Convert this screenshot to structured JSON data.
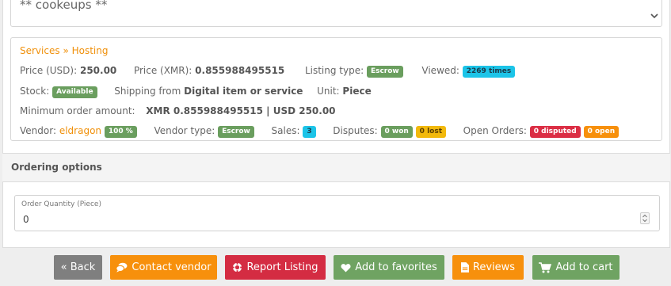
{
  "description": {
    "text": "** cookeups **"
  },
  "listing": {
    "breadcrumb": {
      "category": "Services",
      "separator": "»",
      "subcategory": "Hosting"
    },
    "price_usd_label": "Price (USD):",
    "price_usd": "250.00",
    "price_xmr_label": "Price (XMR):",
    "price_xmr": "0.855988495515",
    "listing_type_label": "Listing type:",
    "listing_type": "Escrow",
    "viewed_label": "Viewed:",
    "viewed": "2269 times",
    "stock_label": "Stock:",
    "stock": "Available",
    "shipping_label": "Shipping from",
    "shipping": "Digital item or service",
    "unit_label": "Unit:",
    "unit": "Piece",
    "min_order_label": "Minimum order amount:",
    "min_order": "XMR 0.855988495515 | USD 250.00",
    "vendor_label": "Vendor:",
    "vendor": "eldragon",
    "vendor_rating": "100 %",
    "vendor_type_label": "Vendor type:",
    "vendor_type": "Escrow",
    "sales_label": "Sales:",
    "sales": "3",
    "disputes_label": "Disputes:",
    "disputes_won": "0 won",
    "disputes_lost": "0 lost",
    "open_orders_label": "Open Orders:",
    "open_disputed": "0 disputed",
    "open_open": "0 open"
  },
  "ordering": {
    "title": "Ordering options",
    "quantity_label": "Order Quantity (Piece)",
    "quantity_value": "0"
  },
  "buttons": {
    "back": "« Back",
    "contact": "Contact vendor",
    "report": "Report Listing",
    "favorites": "Add to favorites",
    "reviews": "Reviews",
    "cart": "Add to cart"
  },
  "colors": {
    "link": "#f0900a",
    "green": "#6fa362",
    "orange": "#f7900c",
    "red": "#d42c42",
    "cyan": "#1cc4e8",
    "yellow": "#f2b90c",
    "gray": "#7f7f7f"
  }
}
